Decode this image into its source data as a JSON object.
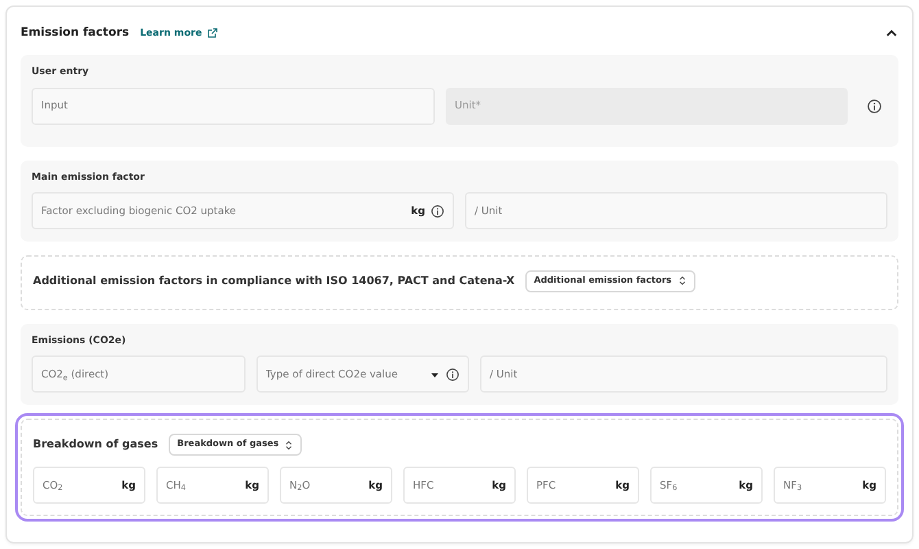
{
  "header": {
    "title": "Emission factors",
    "link": "Learn more",
    "expanded": true
  },
  "sections": [
    {
      "kind": "filled",
      "title": "User entry",
      "highlighted": false,
      "info": true,
      "fields": [
        {
          "placeholder": "Input",
          "disabled": false
        },
        {
          "placeholder": "Unit*",
          "disabled": true
        }
      ]
    },
    {
      "kind": "filled",
      "title": "Main emission factor",
      "highlighted": false,
      "fields": [
        {
          "placeholder": "Factor excluding biogenic CO2 uptake",
          "unit": "kg",
          "info": true
        },
        {
          "placeholder": "/ Unit"
        }
      ]
    },
    {
      "kind": "dashed",
      "title": "Additional emission factors in compliance with ISO 14067, PACT and Catena-X",
      "select": "Additional emission factors",
      "highlighted": false
    },
    {
      "kind": "filled",
      "title": "Emissions (CO2e)",
      "highlighted": false,
      "fields": [
        {
          "placeholder": "CO2$_{e}$ (direct)"
        },
        {
          "placeholder": "Type of direct CO2e value",
          "dropdown": true,
          "info": true
        },
        {
          "placeholder": "/ Unit",
          "wide": true
        }
      ]
    },
    {
      "kind": "dashed",
      "title": "Breakdown of gases",
      "select": "Breakdown of gases",
      "highlighted": true,
      "fields": [
        {
          "placeholder": "CO$_{2}$",
          "unit": "kg"
        },
        {
          "placeholder": "CH$_{4}$",
          "unit": "kg"
        },
        {
          "placeholder": "N$_{2}$O",
          "unit": "kg"
        },
        {
          "placeholder": "HFC",
          "unit": "kg"
        },
        {
          "placeholder": "PFC",
          "unit": "kg"
        },
        {
          "placeholder": "SF$_{6}$",
          "unit": "kg"
        },
        {
          "placeholder": "NF$_{3}$",
          "unit": "kg"
        }
      ]
    }
  ]
}
